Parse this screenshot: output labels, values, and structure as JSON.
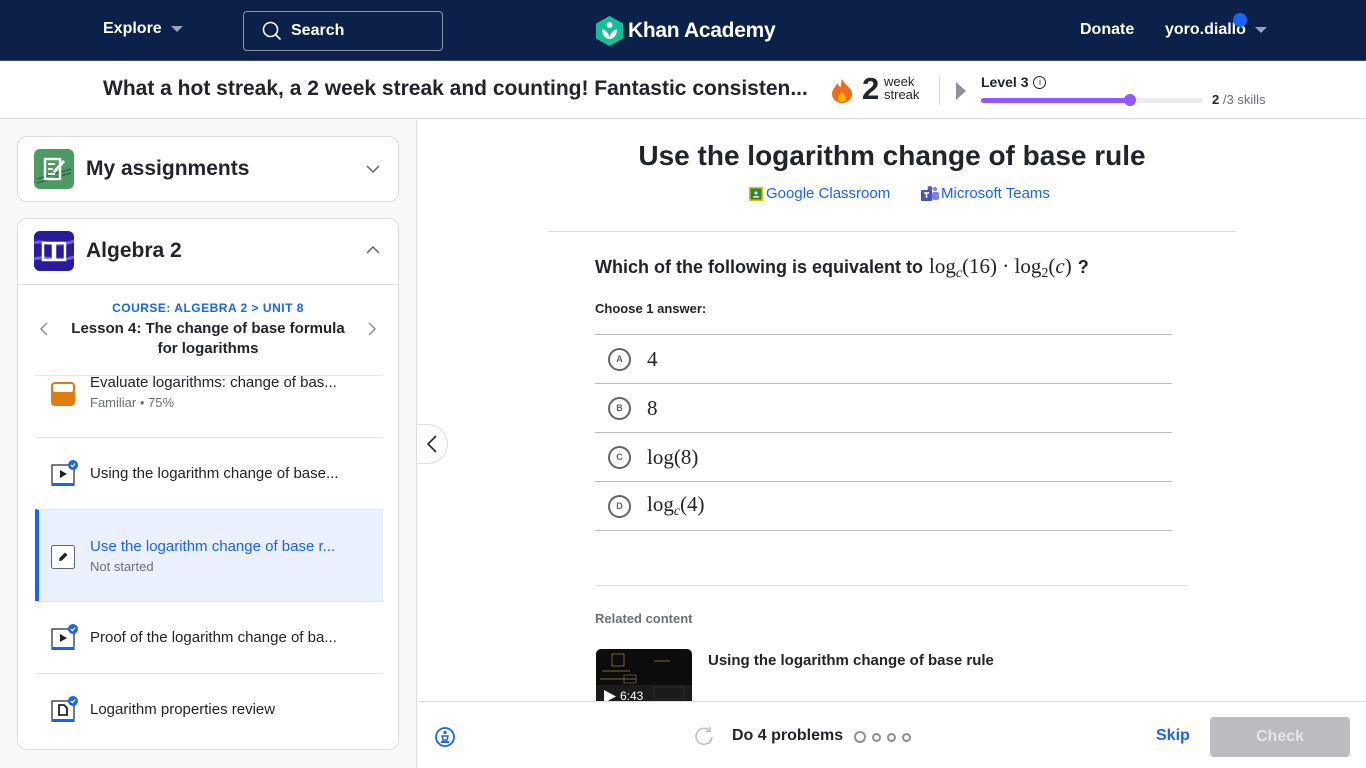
{
  "topnav": {
    "explore_label": "Explore",
    "search_placeholder": "Search",
    "logo_text": "Khan Academy",
    "donate_label": "Donate",
    "username": "yoro.diallo"
  },
  "streak": {
    "message": "What a hot streak, a 2 week streak and counting! Fantastic consisten...",
    "count": "2",
    "unit_line1": "week",
    "unit_line2": "streak",
    "level_label": "Level 3",
    "level_progress_fraction": 0.67,
    "skills_done": "2",
    "skills_total": "/3 skills"
  },
  "sidebar": {
    "assignments_title": "My assignments",
    "course_title": "Algebra 2",
    "breadcrumb_course": "COURSE: ALGEBRA 2",
    "breadcrumb_sep": ">",
    "breadcrumb_unit": "UNIT 8",
    "lesson_title": "Lesson 4: The change of base formula for logarithms",
    "items": [
      {
        "title": "Evaluate logarithms: change of bas...",
        "status": "Familiar • 75%",
        "type": "exercise-familiar"
      },
      {
        "title": "Using the logarithm change of base...",
        "status": "",
        "type": "video-complete"
      },
      {
        "title": "Use the logarithm change of base r...",
        "status": "Not started",
        "type": "exercise-active"
      },
      {
        "title": "Proof of the logarithm change of ba...",
        "status": "",
        "type": "video-complete"
      },
      {
        "title": "Logarithm properties review",
        "status": "",
        "type": "article-complete"
      }
    ]
  },
  "main": {
    "title": "Use the logarithm change of base rule",
    "google_classroom": "Google Classroom",
    "microsoft_teams": "Microsoft Teams",
    "question_prefix": "Which of the following is equivalent to",
    "question_suffix": "?",
    "choose_label": "Choose 1 answer:",
    "choices": [
      {
        "letter": "A",
        "text": "4"
      },
      {
        "letter": "B",
        "text": "8"
      },
      {
        "letter": "C",
        "text": "log(8)"
      },
      {
        "letter": "D",
        "text": "log_c(4)"
      }
    ],
    "related_label": "Related content",
    "related_video": {
      "title": "Using the logarithm change of base rule",
      "duration": "6:43"
    }
  },
  "footer": {
    "do_problems": "Do 4 problems",
    "problem_count": 4,
    "skip_label": "Skip",
    "check_label": "Check"
  },
  "colors": {
    "nav_bg": "#0b2149",
    "accent_blue": "#1865f2",
    "level_purple": "#9059ff",
    "familiar_orange": "#e07d10"
  }
}
